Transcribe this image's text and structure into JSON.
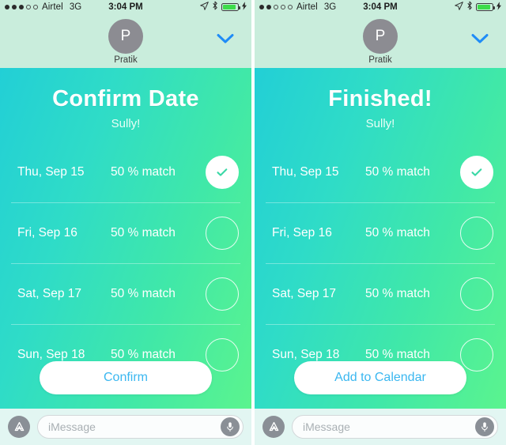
{
  "screens": [
    {
      "statusbar": {
        "signal_filled": 3,
        "signal_total": 5,
        "carrier": "Airtel",
        "network": "3G",
        "time": "3:04 PM",
        "icons": [
          "location-arrow-icon",
          "bluetooth-icon",
          "battery-icon",
          "charging-bolt-icon"
        ]
      },
      "header": {
        "avatar_initial": "P",
        "contact_name": "Pratik",
        "expand_icon": "chevron-down-icon"
      },
      "card": {
        "title": "Confirm Date",
        "subtitle": "Sully!",
        "rows": [
          {
            "date": "Thu, Sep 15",
            "match": "50 % match",
            "selected": true
          },
          {
            "date": "Fri, Sep 16",
            "match": "50 % match",
            "selected": false
          },
          {
            "date": "Sat, Sep 17",
            "match": "50 % match",
            "selected": false
          },
          {
            "date": "Sun, Sep 18",
            "match": "50 % match",
            "selected": false
          }
        ],
        "cta_label": "Confirm"
      },
      "imessage": {
        "app_icon": "app-store-icon",
        "placeholder": "iMessage",
        "value": "",
        "mic_icon": "microphone-icon"
      }
    },
    {
      "statusbar": {
        "signal_filled": 2,
        "signal_total": 5,
        "carrier": "Airtel",
        "network": "3G",
        "time": "3:04 PM",
        "icons": [
          "location-arrow-icon",
          "bluetooth-icon",
          "battery-icon",
          "charging-bolt-icon"
        ]
      },
      "header": {
        "avatar_initial": "P",
        "contact_name": "Pratik",
        "expand_icon": "chevron-down-icon"
      },
      "card": {
        "title": "Finished!",
        "subtitle": "Sully!",
        "rows": [
          {
            "date": "Thu, Sep 15",
            "match": "50 % match",
            "selected": true
          },
          {
            "date": "Fri, Sep 16",
            "match": "50 % match",
            "selected": false
          },
          {
            "date": "Sat, Sep 17",
            "match": "50 % match",
            "selected": false
          },
          {
            "date": "Sun, Sep 18",
            "match": "50 % match",
            "selected": false
          }
        ],
        "cta_label": "Add to Calendar"
      },
      "imessage": {
        "app_icon": "app-store-icon",
        "placeholder": "iMessage",
        "value": "",
        "mic_icon": "microphone-icon"
      }
    }
  ],
  "colors": {
    "gradient_start": "#22cfd6",
    "gradient_end": "#5bf48e",
    "header_bg": "#c9eddc",
    "cta_text": "#3ab7f0",
    "imessage_bg": "#e2f6f2",
    "battery_fill": "#3ddc4a",
    "chevron": "#1f8cf7"
  }
}
